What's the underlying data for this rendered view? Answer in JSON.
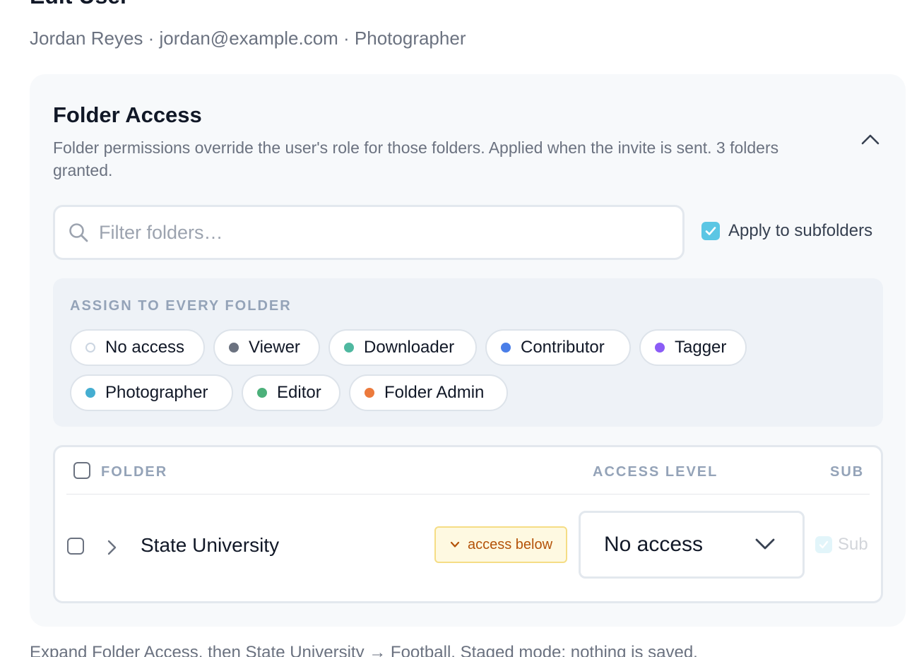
{
  "page": {
    "title": "Edit User",
    "user_meta": "Jordan Reyes · jordan@example.com · Photographer"
  },
  "folder_access": {
    "title": "Folder Access",
    "description": "Folder permissions override the user's role for those folders. Applied when the invite is sent. 3 folders granted.",
    "search_placeholder": "Filter folders…",
    "search_value": "",
    "apply_to_subfolders": {
      "label": "Apply to subfolders",
      "checked": true
    },
    "assign": {
      "title": "ASSIGN TO EVERY FOLDER",
      "roles": [
        {
          "label": "No access",
          "color": "#cbd5e1"
        },
        {
          "label": "Viewer",
          "color": "#6b7280"
        },
        {
          "label": "Downloader",
          "color": "#4fb8a0"
        },
        {
          "label": "Contributor",
          "color": "#4a7ee8"
        },
        {
          "label": "Tagger",
          "color": "#8b5cf6"
        },
        {
          "label": "Photographer",
          "color": "#45aed1"
        },
        {
          "label": "Editor",
          "color": "#4cb07a"
        },
        {
          "label": "Folder Admin",
          "color": "#ec7a3c"
        }
      ]
    },
    "table": {
      "headers": {
        "folder": "FOLDER",
        "access_level": "ACCESS LEVEL",
        "sub": "SUB"
      },
      "rows": [
        {
          "name": "State University",
          "badge": "access below",
          "access_level": "No access",
          "sub_label": "Sub",
          "sub_checked": true,
          "sub_disabled": true
        }
      ]
    }
  },
  "footnote": "Expand Folder Access, then State University → Football. Staged mode: nothing is saved.",
  "colors": {
    "accent": "#5bc6e4",
    "badge_bg": "#fef9e1",
    "badge_text": "#b45309",
    "panel_bg": "#f7f9fb"
  }
}
